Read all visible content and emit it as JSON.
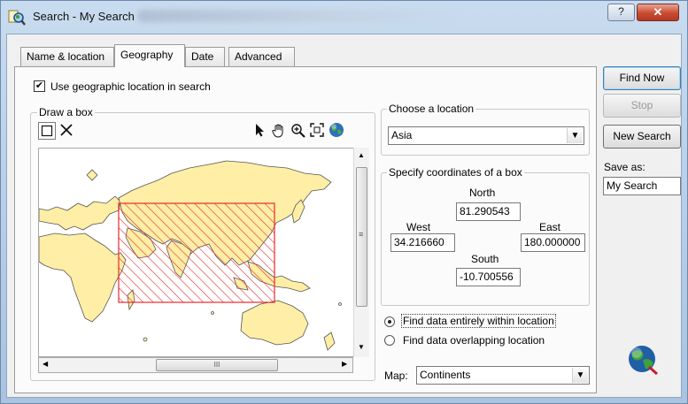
{
  "window": {
    "title": "Search - My Search",
    "help_glyph": "?",
    "close_glyph": "✕"
  },
  "tabs": [
    {
      "label": "Name & location",
      "active": false
    },
    {
      "label": "Geography",
      "active": true
    },
    {
      "label": "Date",
      "active": false
    },
    {
      "label": "Advanced",
      "active": false
    }
  ],
  "geography": {
    "use_location_label": "Use geographic location in search",
    "use_location_checked": true,
    "draw_box_label": "Draw a box",
    "choose_location_label": "Choose a location",
    "location_value": "Asia",
    "coords_label": "Specify coordinates of a box",
    "north_label": "North",
    "north_value": "81.290543",
    "west_label": "West",
    "west_value": "34.216660",
    "east_label": "East",
    "east_value": "180.000000",
    "south_label": "South",
    "south_value": "-10.700556",
    "options": [
      {
        "label": "Find data entirely within location",
        "selected": true
      },
      {
        "label": "Find data overlapping location",
        "selected": false
      }
    ],
    "map_label": "Map:",
    "map_value": "Continents",
    "hscroll_grip": "III",
    "vscroll_grip": "≡"
  },
  "side": {
    "find_now": "Find Now",
    "stop": "Stop",
    "new_search": "New Search",
    "save_as_label": "Save as:",
    "save_as_value": "My Search"
  },
  "colors": {
    "land": "#ffeea5",
    "selection": "#e8282a",
    "coastline": "#555555"
  }
}
